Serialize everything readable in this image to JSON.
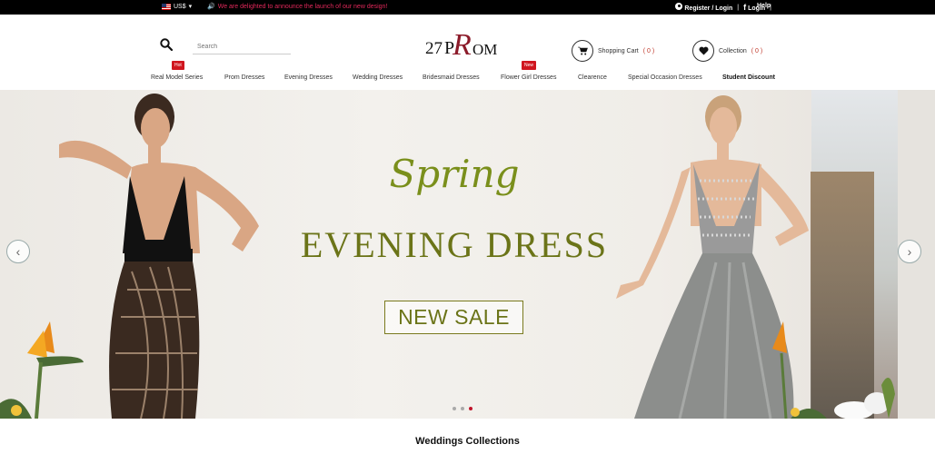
{
  "topbar": {
    "currency": "US$",
    "announcement": "We are delighted to announce the launch of our new design!",
    "register_login": "Register / Login",
    "facebook_login": "Login",
    "help": "Help",
    "separator": "|"
  },
  "search": {
    "placeholder": "Search"
  },
  "logo": {
    "part1": "27",
    "part2": "P",
    "part3": "R",
    "part4": "OM"
  },
  "header": {
    "cart_label": "Shopping Cart",
    "cart_count": "( 0 )",
    "collection_label": "Collection",
    "collection_count": "( 0 )"
  },
  "nav": {
    "items": [
      "Real Model Series",
      "Prom Dresses",
      "Evening Dresses",
      "Wedding Dresses",
      "Bridesmaid Dresses",
      "Flower Girl Dresses",
      "Clearence",
      "Special Occasion Dresses",
      "Student Discount"
    ],
    "tags": {
      "hot": "Hot",
      "new": "New"
    }
  },
  "banner": {
    "script_title": "Spring",
    "main_title": "EVENING DRESS",
    "cta": "NEW SALE",
    "slide_count": 3,
    "active_slide": 3
  },
  "section": {
    "title": "Weddings Collections"
  },
  "colors": {
    "accent": "#c0142a",
    "banner_text": "#6b7418",
    "announcement": "#e0285a"
  }
}
